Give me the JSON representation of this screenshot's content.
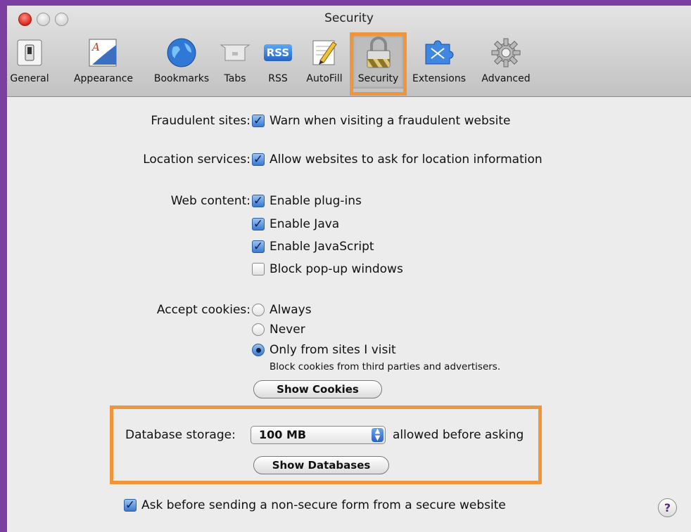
{
  "window": {
    "title": "Security"
  },
  "toolbar": {
    "items": [
      {
        "label": "General"
      },
      {
        "label": "Appearance"
      },
      {
        "label": "Bookmarks"
      },
      {
        "label": "Tabs"
      },
      {
        "label": "RSS",
        "badge": "RSS"
      },
      {
        "label": "AutoFill"
      },
      {
        "label": "Security",
        "selected": true
      },
      {
        "label": "Extensions"
      },
      {
        "label": "Advanced"
      }
    ]
  },
  "fraud": {
    "label": "Fraudulent sites:",
    "option": "Warn when visiting a fraudulent website",
    "checked": true
  },
  "location": {
    "label": "Location services:",
    "option": "Allow websites to ask for location information",
    "checked": true
  },
  "web_content": {
    "label": "Web content:",
    "options": [
      {
        "text": "Enable plug-ins",
        "checked": true
      },
      {
        "text": "Enable Java",
        "checked": true
      },
      {
        "text": "Enable JavaScript",
        "checked": true
      },
      {
        "text": "Block pop-up windows",
        "checked": false
      }
    ]
  },
  "cookies": {
    "label": "Accept cookies:",
    "options": [
      {
        "text": "Always",
        "selected": false
      },
      {
        "text": "Never",
        "selected": false
      },
      {
        "text": "Only from sites I visit",
        "selected": true
      }
    ],
    "note": "Block cookies from third parties and advertisers.",
    "button": "Show Cookies"
  },
  "database": {
    "label": "Database storage:",
    "value": "100 MB",
    "suffix": "allowed before asking",
    "button": "Show Databases"
  },
  "nonsecure": {
    "text": "Ask before sending a non-secure form from a secure website",
    "checked": true
  },
  "help": {
    "glyph": "?"
  },
  "colors": {
    "highlight": "#f0953a",
    "frame": "#7a3fa0",
    "checkbox_on": "#3a78d4"
  }
}
